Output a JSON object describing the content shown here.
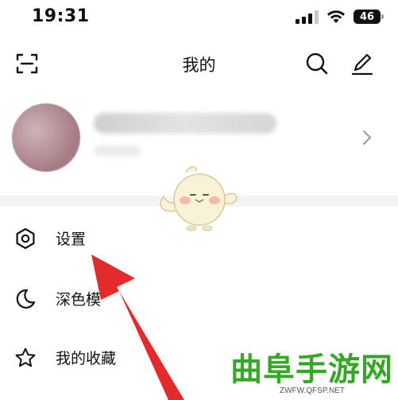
{
  "status_bar": {
    "time": "19:31",
    "battery": "46"
  },
  "header": {
    "title": "我的"
  },
  "menu": {
    "items": [
      {
        "label": "设置"
      },
      {
        "label": "深色模"
      },
      {
        "label": "我的收藏"
      }
    ]
  },
  "watermark": {
    "text": "曲阜手游网",
    "url": "ZWFW.QFSP.NET"
  },
  "colors": {
    "arrow": "#e32b2b",
    "watermark": "#35a826",
    "divider": "#f4f4f4"
  },
  "icons": [
    "scan-icon",
    "search-icon",
    "edit-icon",
    "settings-icon",
    "moon-icon",
    "star-icon",
    "chevron-right-icon"
  ]
}
